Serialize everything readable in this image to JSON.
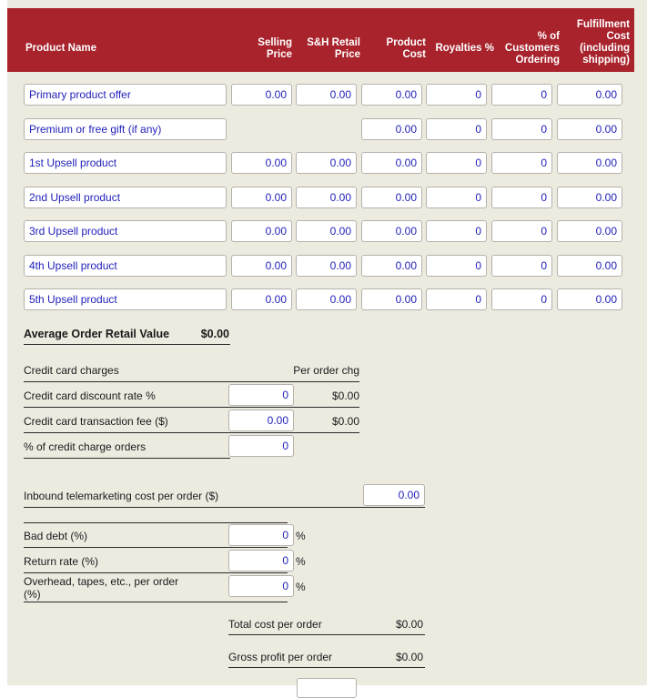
{
  "table": {
    "headers": {
      "product_name": "Product Name",
      "selling_price": "Selling\nPrice",
      "selling_price_l1": "Selling",
      "selling_price_l2": "Price",
      "sh_retail_price_l1": "S&H Retail",
      "sh_retail_price_l2": "Price",
      "product_cost_l1": "Product",
      "product_cost_l2": "Cost",
      "royalties_pct": "Royalties %",
      "customers_ordering_l1": "% of",
      "customers_ordering_l2": "Customers",
      "customers_ordering_l3": "Ordering",
      "fulfillment_l1": "Fulfillment",
      "fulfillment_l2": "Cost",
      "fulfillment_l3": "(including",
      "fulfillment_l4": "shipping)"
    },
    "rows": [
      {
        "name": "Primary product offer",
        "selling_price": "0.00",
        "sh_retail_price": "0.00",
        "product_cost": "0.00",
        "royalties_pct": "0",
        "customers_ordering": "0",
        "fulfillment_cost": "0.00",
        "has_selling_price": true,
        "has_sh_price": true
      },
      {
        "name": "Premium or free gift (if any)",
        "selling_price": "",
        "sh_retail_price": "",
        "product_cost": "0.00",
        "royalties_pct": "0",
        "customers_ordering": "0",
        "fulfillment_cost": "0.00",
        "has_selling_price": false,
        "has_sh_price": false
      },
      {
        "name": "1st Upsell product",
        "selling_price": "0.00",
        "sh_retail_price": "0.00",
        "product_cost": "0.00",
        "royalties_pct": "0",
        "customers_ordering": "0",
        "fulfillment_cost": "0.00",
        "has_selling_price": true,
        "has_sh_price": true
      },
      {
        "name": "2nd Upsell product",
        "selling_price": "0.00",
        "sh_retail_price": "0.00",
        "product_cost": "0.00",
        "royalties_pct": "0",
        "customers_ordering": "0",
        "fulfillment_cost": "0.00",
        "has_selling_price": true,
        "has_sh_price": true
      },
      {
        "name": "3rd Upsell product",
        "selling_price": "0.00",
        "sh_retail_price": "0.00",
        "product_cost": "0.00",
        "royalties_pct": "0",
        "customers_ordering": "0",
        "fulfillment_cost": "0.00",
        "has_selling_price": true,
        "has_sh_price": true
      },
      {
        "name": "4th Upsell product",
        "selling_price": "0.00",
        "sh_retail_price": "0.00",
        "product_cost": "0.00",
        "royalties_pct": "0",
        "customers_ordering": "0",
        "fulfillment_cost": "0.00",
        "has_selling_price": true,
        "has_sh_price": true
      },
      {
        "name": "5th Upsell product",
        "selling_price": "0.00",
        "sh_retail_price": "0.00",
        "product_cost": "0.00",
        "royalties_pct": "0",
        "customers_ordering": "0",
        "fulfillment_cost": "0.00",
        "has_selling_price": true,
        "has_sh_price": true
      }
    ]
  },
  "average_order": {
    "label": "Average Order Retail Value",
    "value": "$0.00"
  },
  "credit_card": {
    "section_label": "Credit card charges",
    "per_order_label": "Per order chg",
    "discount_rate": {
      "label": "Credit card discount rate %",
      "value": "0",
      "per_order": "$0.00"
    },
    "transaction_fee": {
      "label": "Credit card transaction fee ($)",
      "value": "0.00",
      "per_order": "$0.00"
    },
    "pct_charge_orders": {
      "label": "% of credit charge orders",
      "value": "0"
    }
  },
  "telemarketing": {
    "label": "Inbound telemarketing cost per order ($)",
    "value": "0.00"
  },
  "rates": {
    "bad_debt": {
      "label": "Bad debt (%)",
      "value": "0",
      "suffix": "%"
    },
    "return_rate": {
      "label": "Return rate (%)",
      "value": "0",
      "suffix": "%"
    },
    "overhead": {
      "label_l1": "Overhead, tapes, etc., per order",
      "label_l2": "(%)",
      "value": "0",
      "suffix": "%"
    }
  },
  "totals": {
    "total_cost": {
      "label": "Total cost per order",
      "value": "$0.00"
    },
    "gross_profit": {
      "label": "Gross profit per order",
      "value": "$0.00"
    }
  },
  "colors": {
    "header_red": "#a8232c",
    "page_bg": "#edeae0",
    "input_text": "#2222bb"
  }
}
